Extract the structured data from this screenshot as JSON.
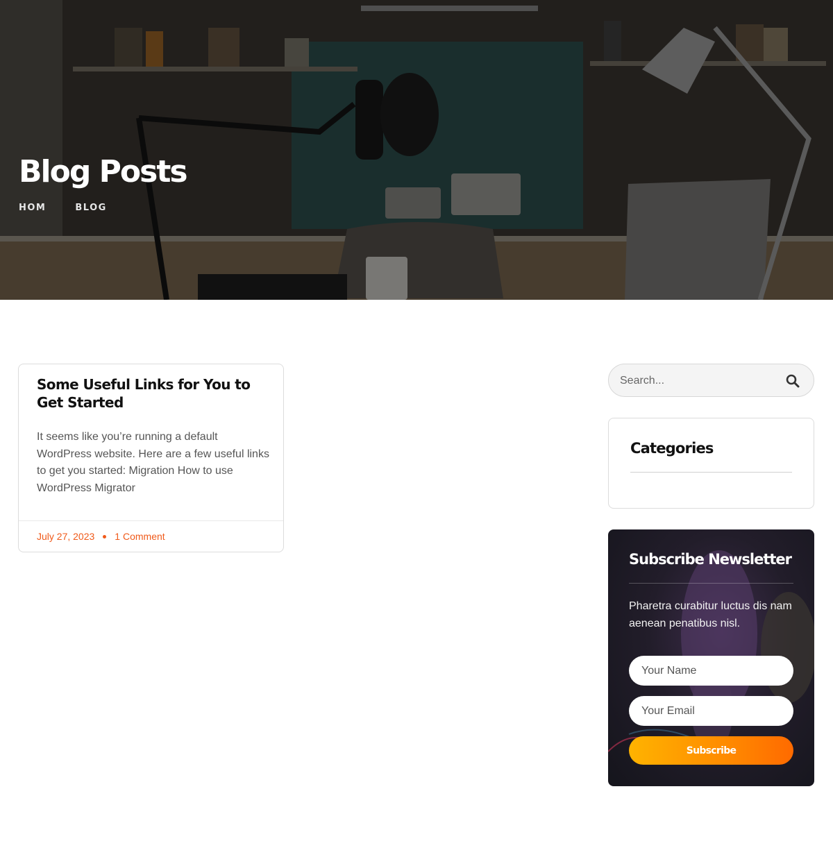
{
  "hero": {
    "title": "Blog Posts",
    "breadcrumb": [
      "HOM",
      "BLOG"
    ]
  },
  "post": {
    "title": "Some Useful Links for You to Get Started",
    "excerpt": "It seems like you’re running a default WordPress website. Here are a few useful links to get you started: Migration How to use WordPress Migrator",
    "date": "July 27, 2023",
    "comments": "1 Comment"
  },
  "sidebar": {
    "search": {
      "placeholder": "Search...",
      "icon": "search-icon"
    },
    "categories": {
      "title": "Categories"
    },
    "newsletter": {
      "title": "Subscribe Newsletter",
      "description": "Pharetra curabitur luctus dis nam aenean penatibus nisl.",
      "name_placeholder": "Your Name",
      "email_placeholder": "Your Email",
      "button_label": "Subscribe"
    }
  },
  "colors": {
    "accent": "#f05a1a",
    "button_gradient_start": "#ffb300",
    "button_gradient_end": "#ff6a00"
  }
}
